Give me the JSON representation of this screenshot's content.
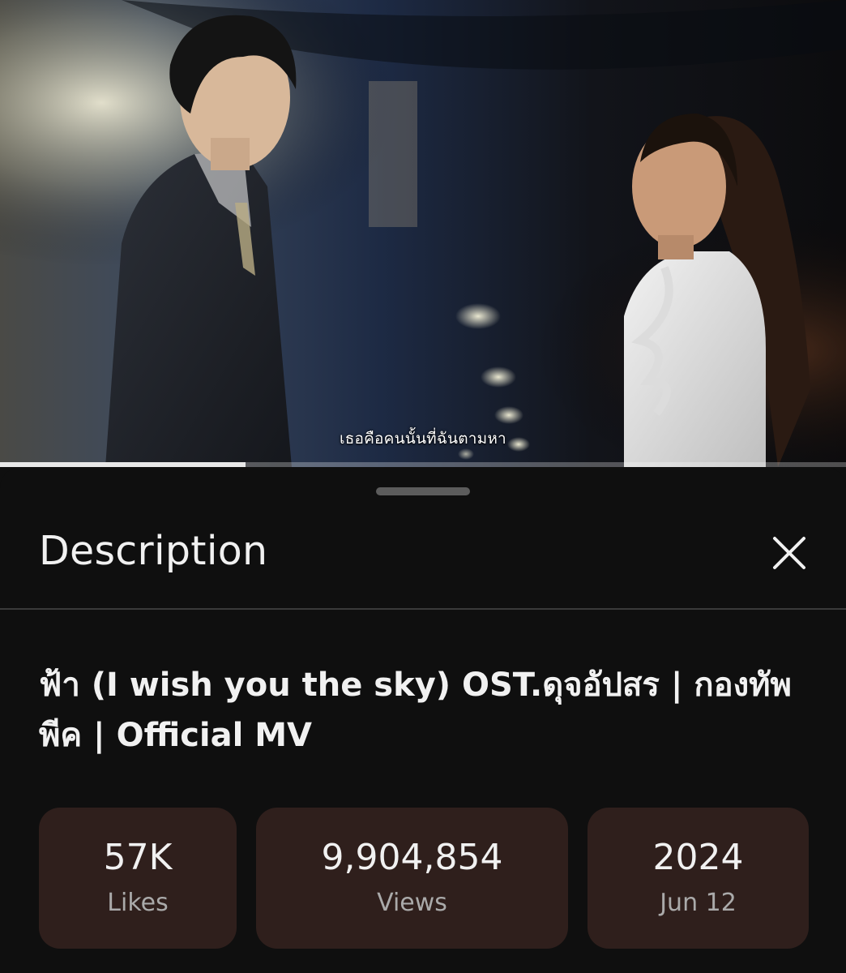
{
  "video": {
    "subtitle": "เธอคือคนนั้นที่ฉันตามหา",
    "progress_fraction": 0.29
  },
  "sheet": {
    "title": "Description",
    "close_icon": "close-icon"
  },
  "description": {
    "video_title": "ฟ้า (I wish you the sky) OST.ดุจอัปสร | กองทัพ พีค | Official MV",
    "stats": [
      {
        "value": "57K",
        "label": "Likes"
      },
      {
        "value": "9,904,854",
        "label": "Views"
      },
      {
        "value": "2024",
        "label": "Jun 12"
      }
    ]
  },
  "colors": {
    "background": "#0f0f0f",
    "stat_box": "#2f1f1c",
    "text_primary": "#f1f1f1",
    "text_secondary": "#aaaaaa"
  }
}
